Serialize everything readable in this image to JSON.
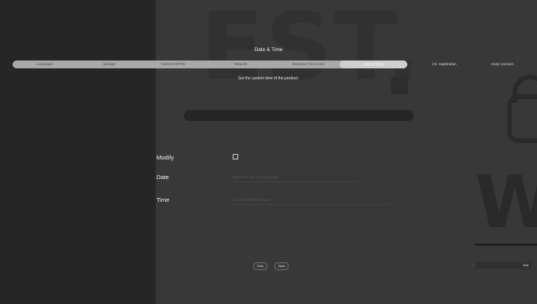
{
  "window": {
    "title": "Date & Time"
  },
  "steps": [
    {
      "label": "Language",
      "state": "done"
    },
    {
      "label": "Storage",
      "state": "done"
    },
    {
      "label": "Camera ID/PW",
      "state": "done"
    },
    {
      "label": "Network",
      "state": "done"
    },
    {
      "label": "Standard Time Zone",
      "state": "done"
    },
    {
      "label": "Date & Time",
      "state": "active"
    },
    {
      "label": "Ch. registration",
      "state": "future"
    },
    {
      "label": "Easy connect",
      "state": "future"
    }
  ],
  "main": {
    "subtitle": "Set the system time of the product.",
    "modify": {
      "label": "Modify",
      "checked": false
    },
    "date": {
      "label": "Date",
      "value": "2024 - 01 - 01   YYYY-MM-DD"
    },
    "time": {
      "label": "Time",
      "value": "12 : 00 : 00   AM   24 hour"
    }
  },
  "footer": {
    "prev_label": "Prev",
    "next_label": "Next",
    "exit_label": "Exit"
  },
  "background": {
    "logo_text": "EST.",
    "side_text": "W"
  },
  "colors": {
    "panel_left": "#262626",
    "panel_right": "#383838",
    "step_track": "#a9a9a9",
    "step_active": "#cfcfcf"
  }
}
